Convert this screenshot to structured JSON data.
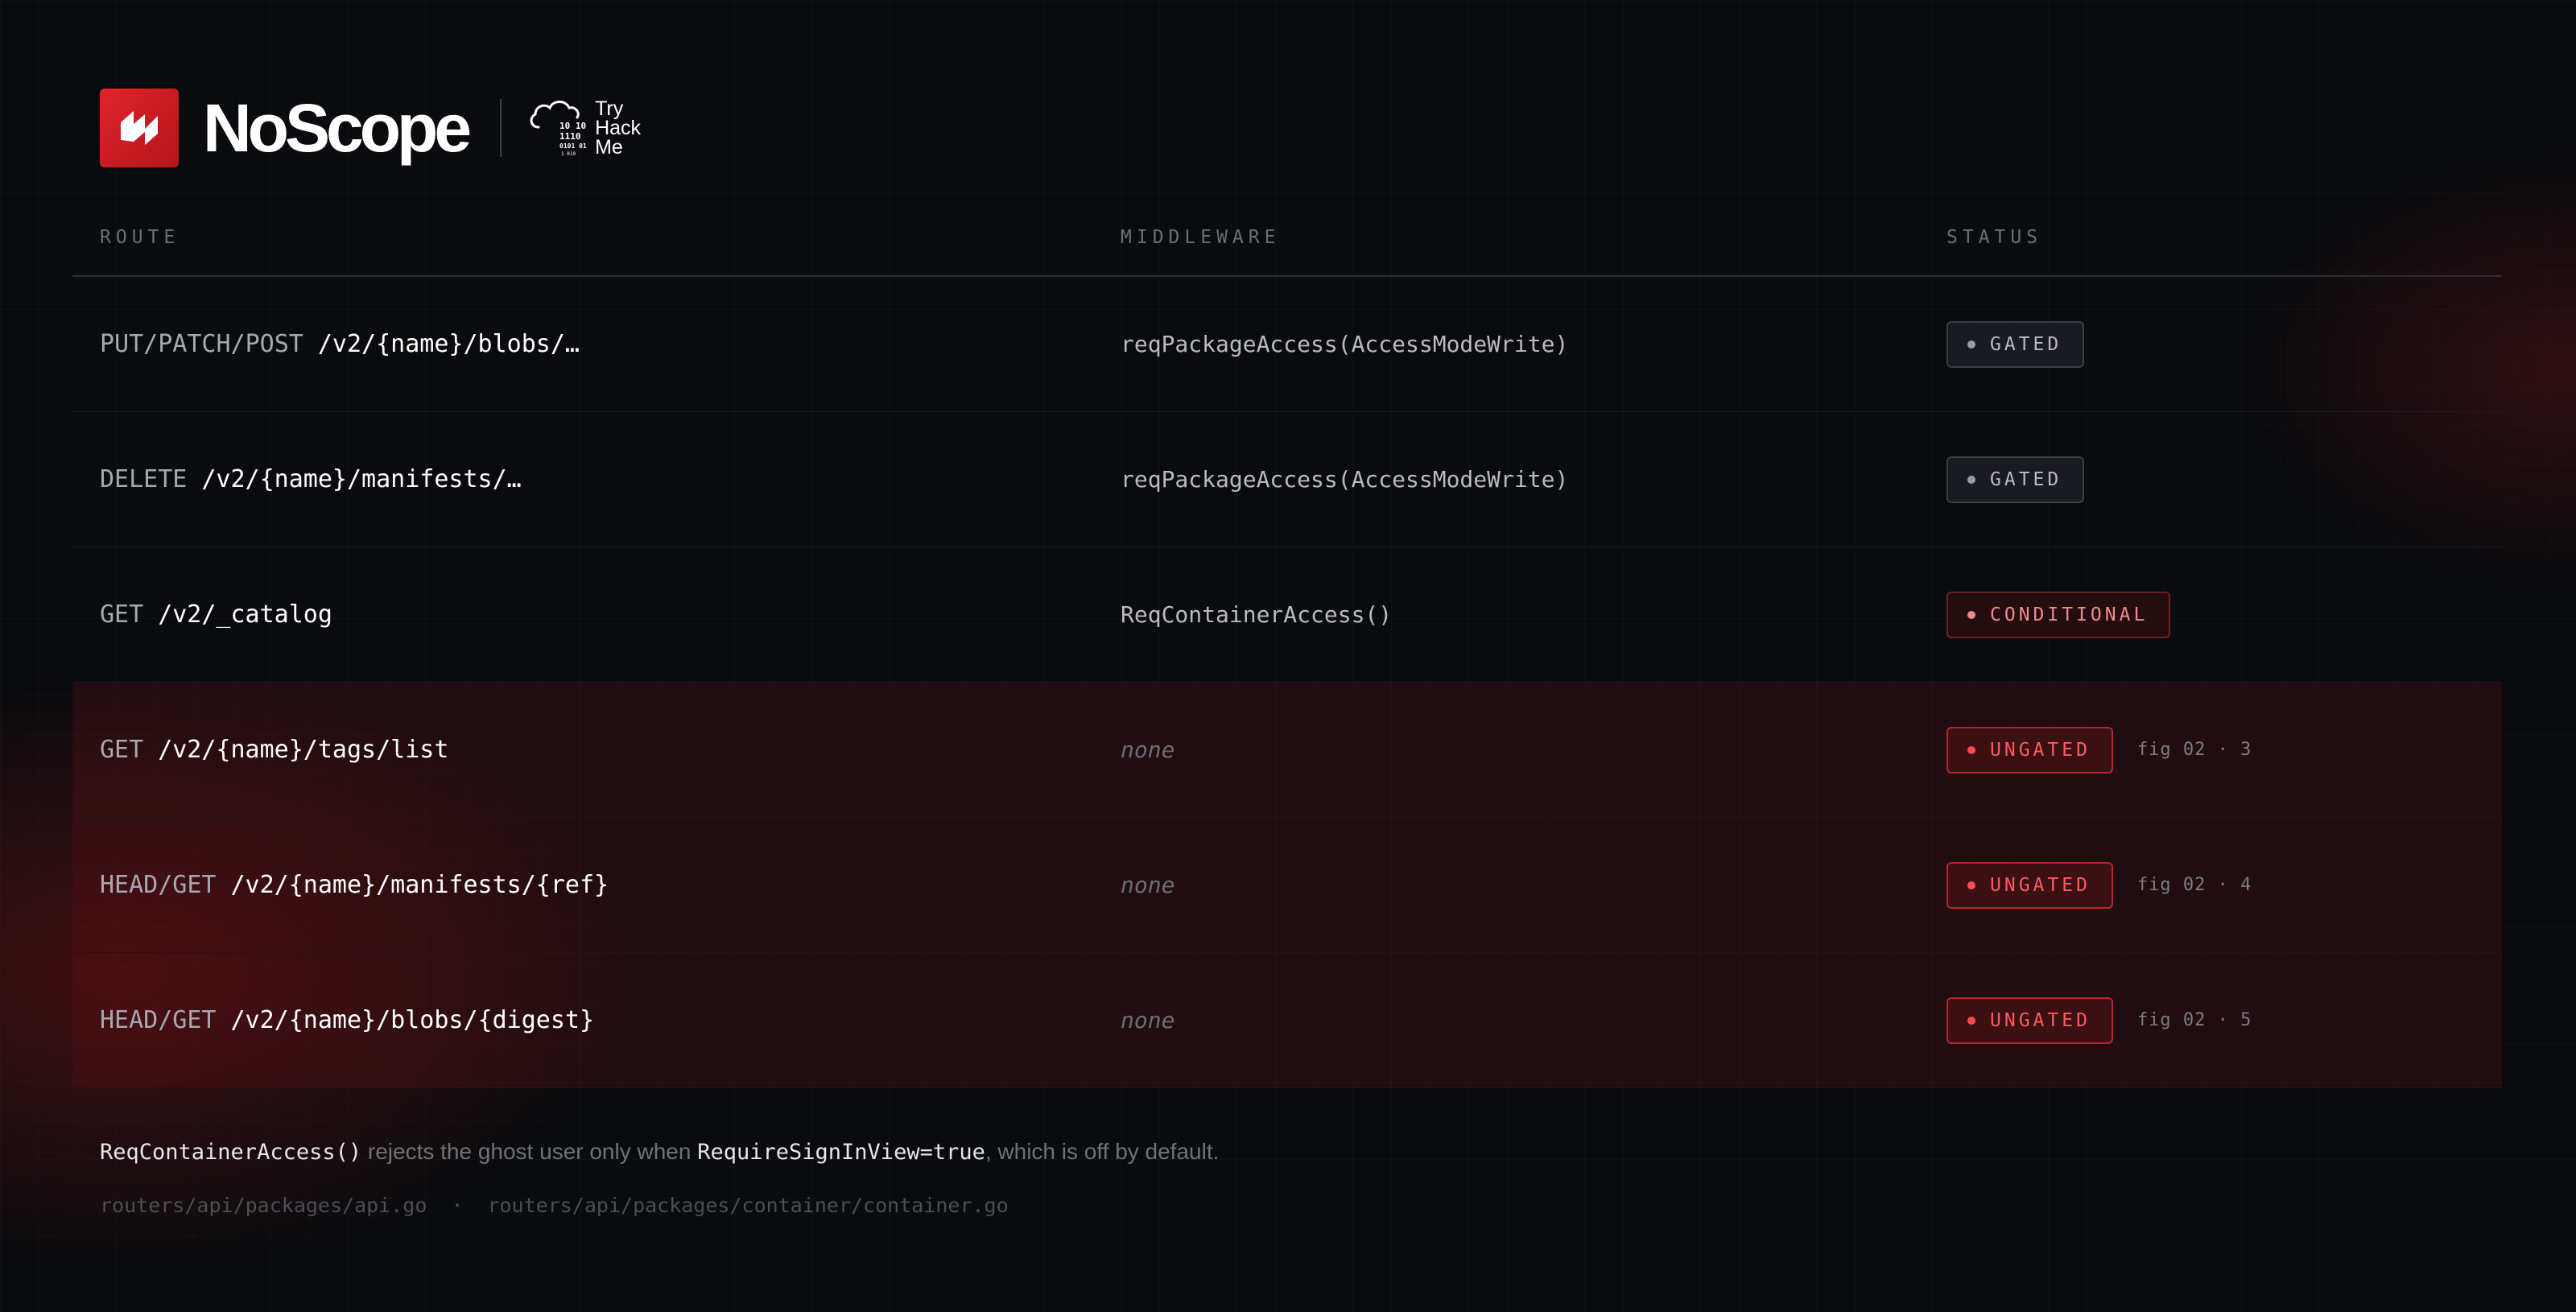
{
  "header": {
    "brand_name": "NoScope",
    "partner_name_line1": "Try",
    "partner_name_line2": "Hack",
    "partner_name_line3": "Me",
    "brand_icon": "noscope-logo-icon",
    "partner_icon": "cloud-binary-icon"
  },
  "table": {
    "columns": {
      "route": "ROUTE",
      "middleware": "MIDDLEWARE",
      "status": "STATUS"
    },
    "rows": [
      {
        "method": "PUT/PATCH/POST",
        "path": "/v2/{name}/blobs/…",
        "middleware": "reqPackageAccess(AccessModeWrite)",
        "status": "GATED",
        "fig": ""
      },
      {
        "method": "DELETE",
        "path": "/v2/{name}/manifests/…",
        "middleware": "reqPackageAccess(AccessModeWrite)",
        "status": "GATED",
        "fig": ""
      },
      {
        "method": "GET",
        "path": "/v2/_catalog",
        "middleware": "ReqContainerAccess()",
        "status": "CONDITIONAL",
        "fig": ""
      },
      {
        "method": "GET",
        "path": "/v2/{name}/tags/list",
        "middleware": "none",
        "status": "UNGATED",
        "fig": "fig 02 · 3"
      },
      {
        "method": "HEAD/GET",
        "path": "/v2/{name}/manifests/{ref}",
        "middleware": "none",
        "status": "UNGATED",
        "fig": "fig 02 · 4"
      },
      {
        "method": "HEAD/GET",
        "path": "/v2/{name}/blobs/{digest}",
        "middleware": "none",
        "status": "UNGATED",
        "fig": "fig 02 · 5"
      }
    ]
  },
  "note": {
    "code1": "ReqContainerAccess()",
    "text1": " rejects the ghost user only when ",
    "code2": "RequireSignInView=true",
    "text2": ", which is off by default."
  },
  "files": {
    "file1": "routers/api/packages/api.go",
    "separator": "·",
    "file2": "routers/api/packages/container/container.go"
  },
  "colors": {
    "accent": "#e0242b",
    "ungated": "#ff5a60",
    "conditional": "#f08a8e",
    "gated": "#b9bac2",
    "background": "#0a0b0e"
  }
}
